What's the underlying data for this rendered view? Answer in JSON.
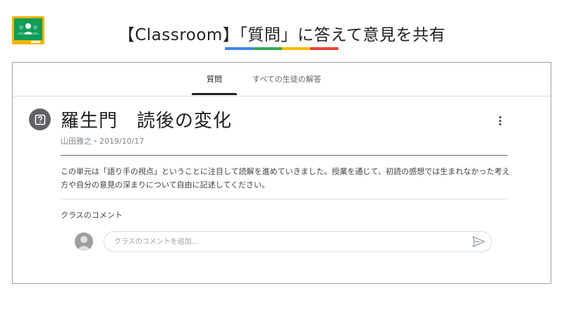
{
  "header": {
    "title": "【Classroom】「質問」に答えて意見を共有",
    "bar_colors": [
      "#4285f4",
      "#34a853",
      "#fbbc04",
      "#ea4335"
    ]
  },
  "tabs": [
    {
      "label": "質問",
      "active": true
    },
    {
      "label": "すべての生徒の解答",
      "active": false
    }
  ],
  "post": {
    "icon": "question-icon",
    "title": "羅生門　読後の変化",
    "meta": "山田雅之・2019/10/17",
    "description": "この単元は「語り手の視点」ということに注目して読解を進めていきました。授業を通じて、初読の感想では生まれなかった考え方や自分の意見の深まりについて自由に記述してください。"
  },
  "comments": {
    "label": "クラスのコメント",
    "placeholder": "クラスのコメントを追加..."
  },
  "colors": {
    "logo_green": "#0f9d58",
    "logo_yellow": "#f4b400",
    "icon_gray": "#5f6368"
  }
}
